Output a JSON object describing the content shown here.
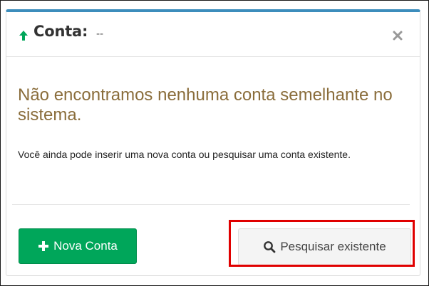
{
  "header": {
    "title": "Conta:",
    "title_value": "--",
    "arrow_icon": "arrow-up-icon",
    "close_icon": "close-icon"
  },
  "message": {
    "headline": "Não encontramos nenhuma conta semelhante no sistema.",
    "body": "Você ainda pode inserir uma nova conta ou pesquisar uma conta existente."
  },
  "buttons": {
    "new_account_label": "Nova Conta",
    "new_account_icon": "plus-icon",
    "search_existing_label": "Pesquisar existente",
    "search_existing_icon": "search-icon"
  },
  "colors": {
    "header_accent": "#3c8dbc",
    "arrow": "#00a65a",
    "headline": "#8a6d3b",
    "primary_button": "#00a65a",
    "default_button": "#f4f4f4",
    "highlight": "#e00000"
  }
}
